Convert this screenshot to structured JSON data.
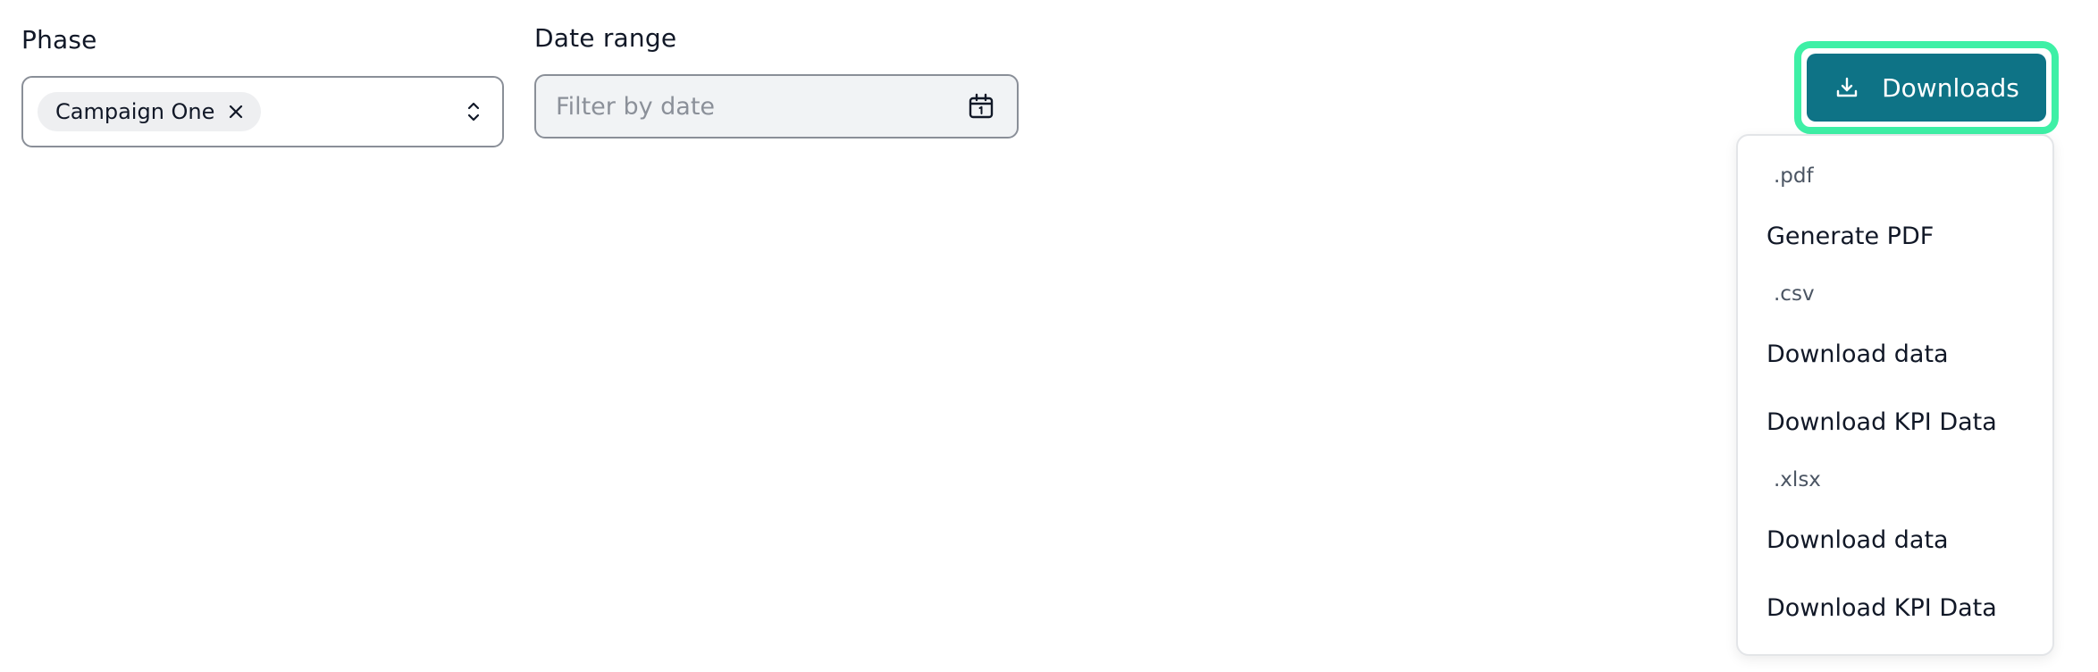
{
  "filters": {
    "phase": {
      "label": "Phase",
      "selected_chip": "Campaign One"
    },
    "date_range": {
      "label": "Date range",
      "placeholder": "Filter by date"
    }
  },
  "downloads": {
    "button_label": "Downloads",
    "menu": {
      "sections": [
        {
          "heading": ".pdf",
          "items": [
            "Generate PDF"
          ]
        },
        {
          "heading": ".csv",
          "items": [
            "Download data",
            "Download KPI Data"
          ]
        },
        {
          "heading": ".xlsx",
          "items": [
            "Download data",
            "Download KPI Data"
          ]
        }
      ]
    }
  },
  "colors": {
    "primary": "#0e7386",
    "focus_ring": "#3ef0a6",
    "border": "#8a8f98",
    "chip_bg": "#eeeff1"
  },
  "icons": {
    "chip_remove": "close-icon",
    "select_toggle": "chevron-up-down-icon",
    "date_picker": "calendar-icon",
    "downloads": "download-icon"
  }
}
